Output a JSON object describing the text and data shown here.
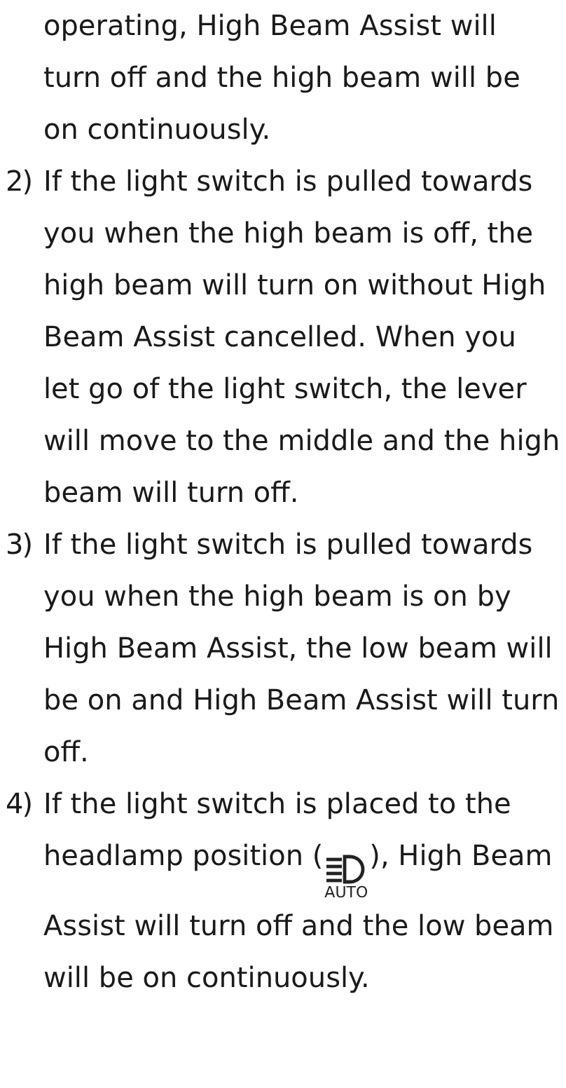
{
  "continuation": "operating, High Beam Assist will turn off and the high beam will be on continuously.",
  "items": [
    {
      "number": "2)",
      "text": "If the light switch is pulled towards you when the high beam is off, the high beam will turn on without High Beam Assist cancelled. When you let go of the light switch, the lever will move to the middle and the high beam will turn off."
    },
    {
      "number": "3)",
      "text": "If the light switch is pulled towards you when the high beam is on by High Beam Assist, the low beam will be on and High Beam Assist will turn off."
    },
    {
      "number": "4)",
      "text": "If the light switch is placed to the headlamp position (",
      "icon_label": "AUTO",
      "text_after": "), High Beam Assist will turn off and the low beam will be on continuously."
    }
  ]
}
